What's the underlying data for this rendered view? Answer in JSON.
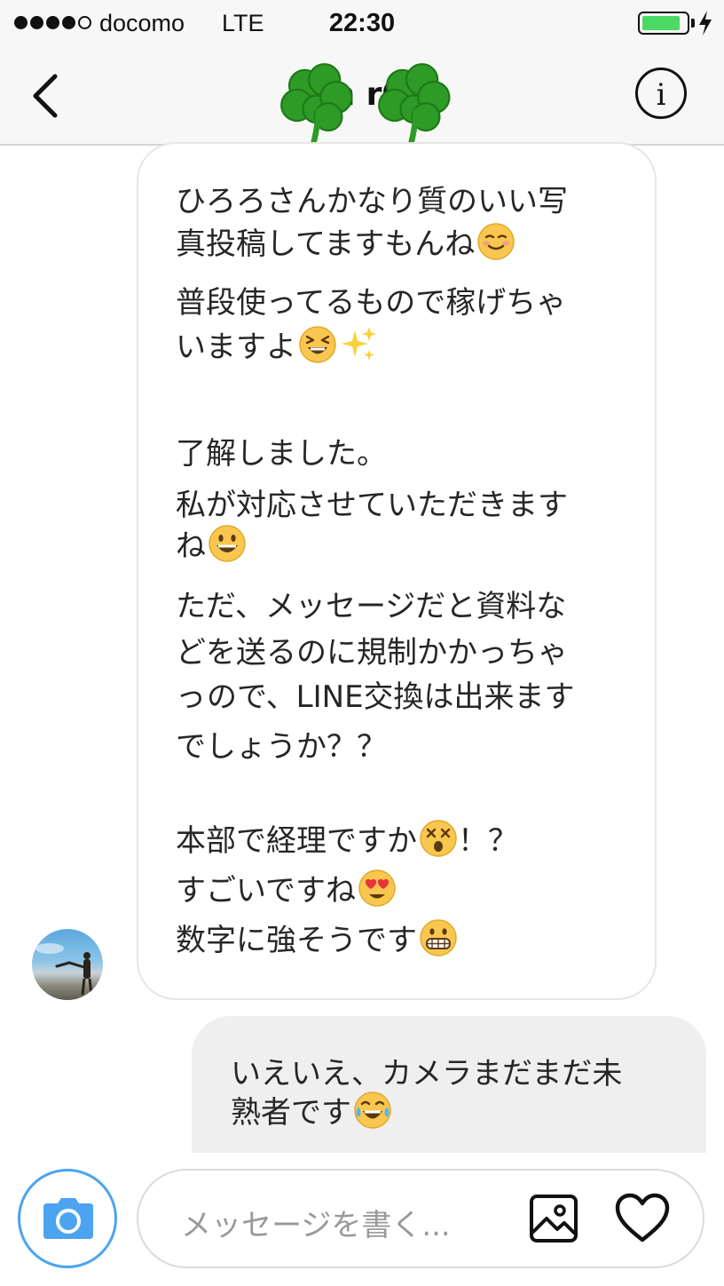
{
  "status_bar": {
    "carrier": "docomo",
    "network": "LTE",
    "time": "22:30",
    "signal_bars": 4,
    "battery_level": 0.85,
    "battery_color": "#4cd964"
  },
  "header": {
    "title": "h r0",
    "back_icon": "chevron-left-icon",
    "info_icon": "info-icon",
    "info_label": "i",
    "decoration_icon": "shamrock-emoji"
  },
  "conversation": {
    "incoming_lines": [
      "ひろろさんかなり質のいい写",
      "真投稿してますもんね",
      "普段使ってるもので稼げちゃ",
      "いますよ",
      "了解しました。",
      "私が対応させていただきます",
      "ね",
      "ただ、メッセージだと資料な",
      "どを送るのに規制かかっちゃ",
      "っので、LINE交換は出来ます",
      "でしょうか？？",
      "本部で経理ですか",
      "！？",
      "すごいですね",
      "数字に強そうです"
    ],
    "outgoing_lines": [
      "いえいえ、カメラまだまだ未",
      "熟者です"
    ],
    "emoji": {
      "relieved": "relieved-face-emoji",
      "laughing": "laughing-face-emoji",
      "sparkles": "sparkles-emoji",
      "smile": "grinning-face-emoji",
      "astonished": "astonished-face-emoji",
      "heart_eyes": "heart-eyes-emoji",
      "grimace": "grimacing-face-emoji",
      "tears_of_joy": "tears-of-joy-emoji"
    },
    "avatar_icon": "user-avatar"
  },
  "composer": {
    "placeholder": "メッセージを書く...",
    "camera_icon": "camera-icon",
    "gallery_icon": "image-icon",
    "like_icon": "heart-icon",
    "accent_color": "#4ca4f0"
  }
}
